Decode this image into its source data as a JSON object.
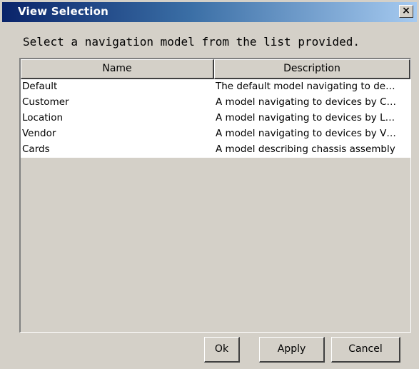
{
  "window": {
    "title": "View Selection",
    "close_glyph": "×"
  },
  "instruction": "Select a navigation model from the list provided.",
  "table": {
    "columns": [
      "Name",
      "Description"
    ],
    "rows": [
      {
        "name": "Default",
        "description": "The default model navigating to de…"
      },
      {
        "name": "Customer",
        "description": "A model navigating to devices by C…"
      },
      {
        "name": "Location",
        "description": "A model navigating to devices by L…"
      },
      {
        "name": "Vendor",
        "description": "A model navigating to devices by V…"
      },
      {
        "name": "Cards",
        "description": "A model describing chassis assembly"
      }
    ]
  },
  "buttons": {
    "ok": "Ok",
    "apply": "Apply",
    "cancel": "Cancel"
  },
  "colors": {
    "title_gradient_start": "#0a246a",
    "title_gradient_end": "#a6caf0",
    "face": "#d4d0c8",
    "row_background": "#ffffff"
  }
}
